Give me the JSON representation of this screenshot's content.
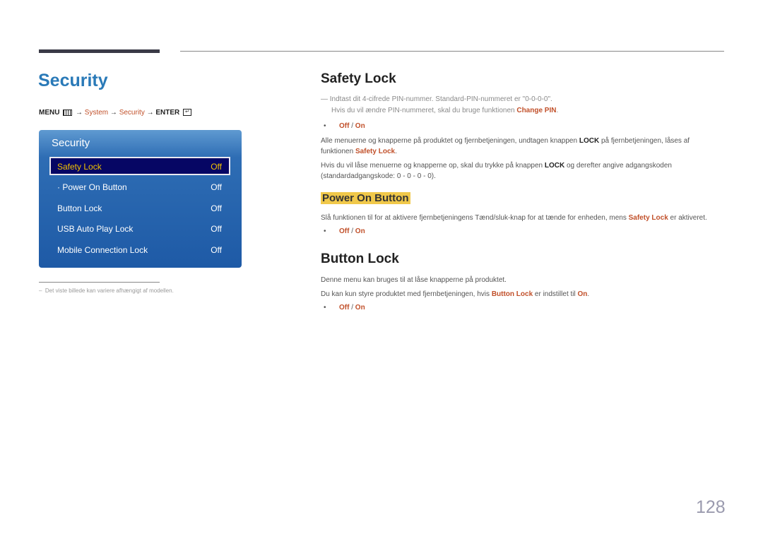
{
  "page": {
    "title": "Security",
    "page_number": "128"
  },
  "menu_path": {
    "menu": "MENU",
    "menu_icon": "menu-icon",
    "arrow": "→",
    "system": "System",
    "security": "Security",
    "enter": "ENTER",
    "enter_icon": "enter-icon"
  },
  "osd_panel": {
    "title": "Security",
    "items": [
      {
        "label": "Safety Lock",
        "value": "Off",
        "selected": true
      },
      {
        "label": "· Power On Button",
        "value": "Off"
      },
      {
        "label": "Button Lock",
        "value": "Off"
      },
      {
        "label": "USB Auto Play Lock",
        "value": "Off"
      },
      {
        "label": "Mobile Connection Lock",
        "value": "Off"
      }
    ],
    "colors": {
      "panel": "#1e5aa6",
      "selected_bg": "#060664",
      "selected_text": "#f2c200"
    }
  },
  "footnote": "Det viste billede kan variere afhængigt af modellen.",
  "sections": {
    "safety_lock": {
      "heading": "Safety Lock",
      "note_line1": "Indtast dit 4-cifrede PIN-nummer. Standard-PIN-nummeret er \"0-0-0-0\".",
      "note_line2_pre": "Hvis du vil ændre PIN-nummeret, skal du bruge funktionen ",
      "note_line2_hl": "Change PIN",
      "note_line2_post": ".",
      "option_off": "Off",
      "option_sep": " / ",
      "option_on": "On",
      "para1_pre": "Alle menuerne og knapperne på produktet og fjernbetjeningen, undtagen knappen ",
      "para1_bold": "LOCK",
      "para1_mid": " på fjernbetjeningen, låses af funktionen ",
      "para1_hl": "Safety Lock",
      "para1_post": ".",
      "para2_pre": "Hvis du vil låse menuerne og knapperne op, skal du trykke på knappen ",
      "para2_bold": "LOCK",
      "para2_post": " og derefter angive adgangskoden (standardadgangskode: 0 - 0 - 0 - 0)."
    },
    "power_on_button": {
      "heading": "Power On Button",
      "para_pre": "Slå funktionen til for at aktivere fjernbetjeningens Tænd/sluk-knap for at tænde for enheden, mens ",
      "para_hl": "Safety Lock",
      "para_post": " er aktiveret.",
      "option_off": "Off",
      "option_sep": " / ",
      "option_on": "On"
    },
    "button_lock": {
      "heading": "Button Lock",
      "para1": "Denne menu kan bruges til at låse knapperne på produktet.",
      "para2_pre": "Du kan kun styre produktet med fjernbetjeningen, hvis ",
      "para2_hl": "Button Lock",
      "para2_mid": " er indstillet til ",
      "para2_hl2": "On",
      "para2_post": ".",
      "option_off": "Off",
      "option_sep": " / ",
      "option_on": "On"
    }
  },
  "colors": {
    "title_blue": "#2a7ab8",
    "accent_orange": "#c1502a",
    "highlight_yellow": "#f0c84a"
  }
}
